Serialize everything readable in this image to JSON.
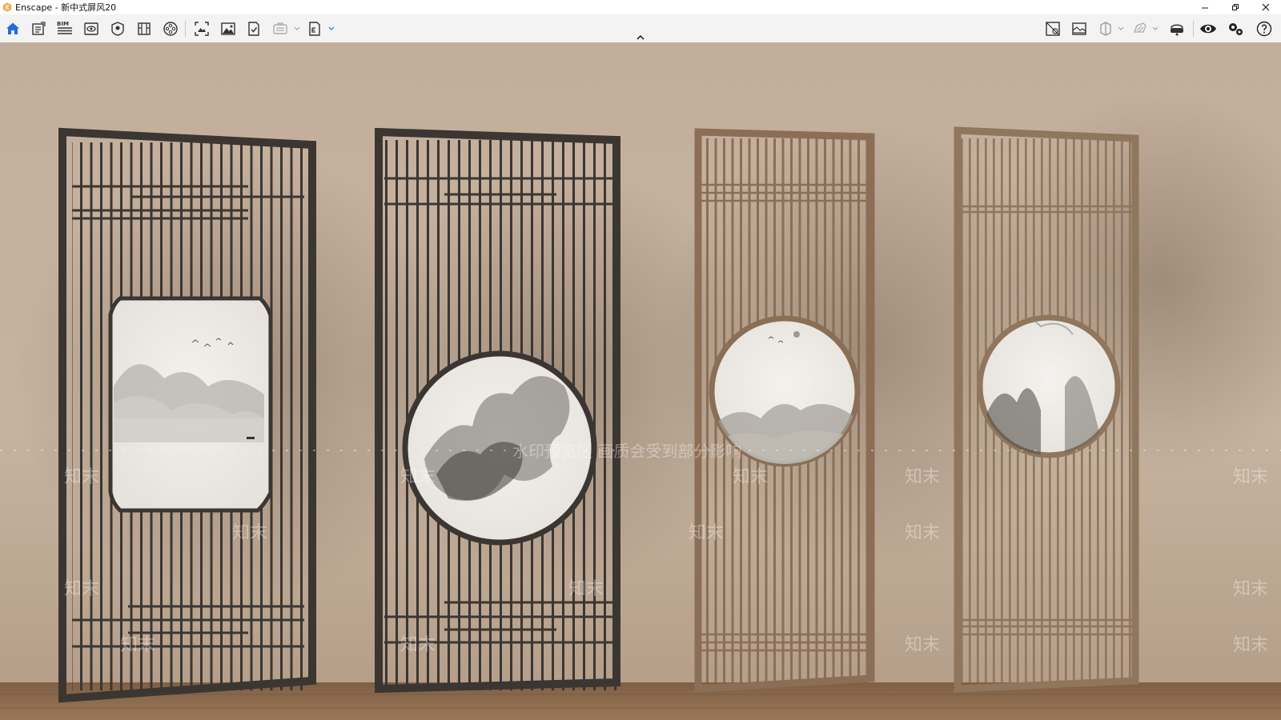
{
  "window": {
    "app_name": "Enscape",
    "title": "Enscape - 新中式屏风20"
  },
  "toolbar": {
    "left_icons": [
      "home-icon",
      "asset-library-icon",
      "bim-icon",
      "view-icon",
      "atmosphere-icon",
      "material-editor-icon",
      "video-editor-icon",
      "screenshot-icon",
      "image-gallery-icon",
      "batch-render-icon",
      "web-export-icon",
      "exe-export-icon"
    ],
    "bim_label": "BIM",
    "right_icons": [
      "views-icon",
      "visual-settings-icon",
      "section-icon",
      "sketch-icon",
      "vr-headset-icon",
      "live-update-icon",
      "settings-icon",
      "help-icon"
    ]
  },
  "viewport": {
    "watermark_banner": "水印预览区  画质会受到部分影响",
    "watermark_brand": "知末"
  },
  "colors": {
    "wall": "#c4b09c",
    "floor": "#8c6a4e",
    "dark_frame": "#3b3632",
    "wood_frame": "#8d7258",
    "accent_blue": "#1e6fd9",
    "paper": "#efece6"
  }
}
